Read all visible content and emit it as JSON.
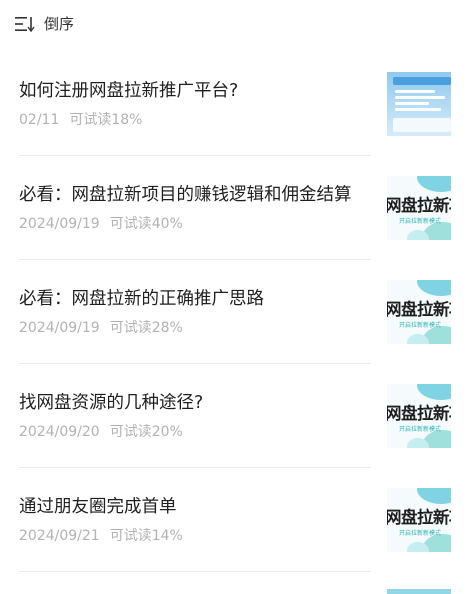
{
  "toolbar": {
    "sort_icon": "sort-icon",
    "sort_label": "倒序"
  },
  "articles": [
    {
      "title": "如何注册网盘拉新推广平台?",
      "date": "02/11",
      "read_rate": "可试读18%",
      "thumb_style": "blue-screenshot"
    },
    {
      "title": "必看：网盘拉新项目的赚钱逻辑和佣金结算",
      "date": "2024/09/19",
      "read_rate": "可试读40%",
      "thumb_style": "cover",
      "thumb_text": "网盘拉新项目",
      "thumb_sub": "开启拉新新模式"
    },
    {
      "title": "必看：网盘拉新的正确推广思路",
      "date": "2024/09/19",
      "read_rate": "可试读28%",
      "thumb_style": "cover",
      "thumb_text": "网盘拉新项目",
      "thumb_sub": "开启拉新新模式"
    },
    {
      "title": "找网盘资源的几种途径?",
      "date": "2024/09/20",
      "read_rate": "可试读20%",
      "thumb_style": "cover",
      "thumb_text": "网盘拉新项目",
      "thumb_sub": "开启拉新新模式"
    },
    {
      "title": "通过朋友圈完成首单",
      "date": "2024/09/21",
      "read_rate": "可试读14%",
      "thumb_style": "cover",
      "thumb_text": "网盘拉新项目",
      "thumb_sub": "开启拉新新模式"
    }
  ],
  "colors": {
    "title": "#1f1f1f",
    "meta": "#b2b2b2",
    "divider": "#ececec",
    "thumb_accent": "#7fd3e3"
  }
}
